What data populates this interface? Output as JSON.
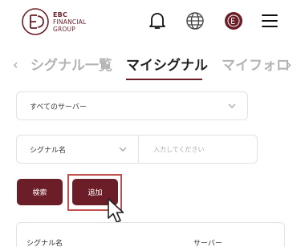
{
  "header": {
    "logo": {
      "line1": "EBC",
      "line2": "FINANCIAL",
      "line3": "GROUP"
    },
    "icons": [
      "bell-icon",
      "globe-icon",
      "brand-badge-icon",
      "hamburger-menu-icon"
    ]
  },
  "tabs": {
    "items": [
      {
        "label": "シグナル一覧",
        "active": false
      },
      {
        "label": "マイシグナル",
        "active": true
      },
      {
        "label": "マイフォロ",
        "active": false
      }
    ]
  },
  "filters": {
    "server_select": {
      "value": "すべてのサーバー"
    },
    "signal_field": {
      "value": "シグナル名"
    },
    "signal_input": {
      "placeholder": "入力してください"
    }
  },
  "actions": {
    "search_label": "検索",
    "add_label": "追加"
  },
  "table": {
    "columns": [
      "シグナル名",
      "サーバー"
    ]
  },
  "colors": {
    "brand": "#6b1e28",
    "highlight": "#c0504d"
  }
}
